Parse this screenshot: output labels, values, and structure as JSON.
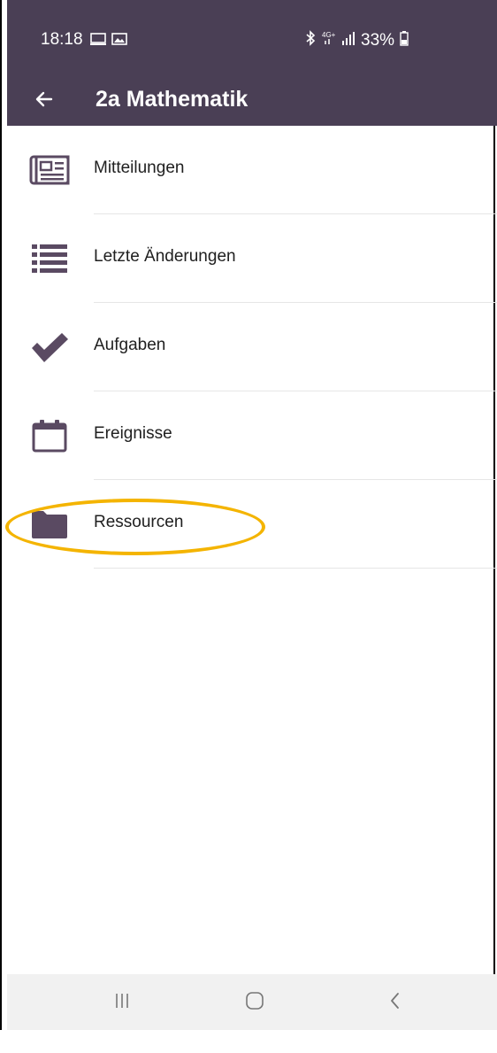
{
  "status_bar": {
    "time": "18:18",
    "battery": "33%",
    "icons": [
      "screen-icon",
      "image-icon",
      "bluetooth-icon",
      "4g-icon",
      "signal-icon",
      "battery-icon"
    ]
  },
  "app_bar": {
    "title": "2a Mathematik",
    "back_icon": "arrow-left-icon"
  },
  "menu": {
    "items": [
      {
        "label": "Mitteilungen",
        "icon": "newspaper-icon"
      },
      {
        "label": "Letzte Änderungen",
        "icon": "list-icon"
      },
      {
        "label": "Aufgaben",
        "icon": "checkmark-icon"
      },
      {
        "label": "Ereignisse",
        "icon": "calendar-icon"
      },
      {
        "label": "Ressourcen",
        "icon": "folder-icon",
        "highlighted": true
      }
    ]
  },
  "colors": {
    "header": "#4a3f55",
    "icon": "#5a4a62",
    "highlight": "#f4b400",
    "nav_bar": "#f1f1f1"
  },
  "nav_bar": {
    "icons": [
      "recent-apps-icon",
      "home-icon",
      "back-icon"
    ]
  }
}
